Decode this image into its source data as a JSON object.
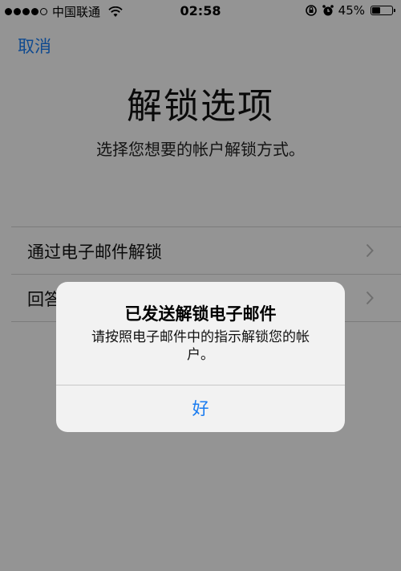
{
  "status_bar": {
    "carrier": "中国联通",
    "time": "02:58",
    "battery_percent": "45%",
    "battery_level": 0.45,
    "signal_bars_filled": 4,
    "signal_bars_total": 5
  },
  "nav": {
    "cancel_label": "取消"
  },
  "page": {
    "title": "解锁选项",
    "subtitle": "选择您想要的帐户解锁方式。"
  },
  "options": [
    {
      "label": "通过电子邮件解锁"
    },
    {
      "label": "回答安全提示问题"
    }
  ],
  "alert": {
    "title": "已发送解锁电子邮件",
    "message": "请按照电子邮件中的指示解锁您的帐户。",
    "ok_label": "好"
  },
  "colors": {
    "accent": "#1a7cf0",
    "background": "#f7f7f7",
    "alert_background": "#f2f2f2"
  },
  "icons": [
    "wifi-icon",
    "rotation-lock-icon",
    "alarm-icon",
    "battery-icon",
    "chevron-right-icon"
  ]
}
